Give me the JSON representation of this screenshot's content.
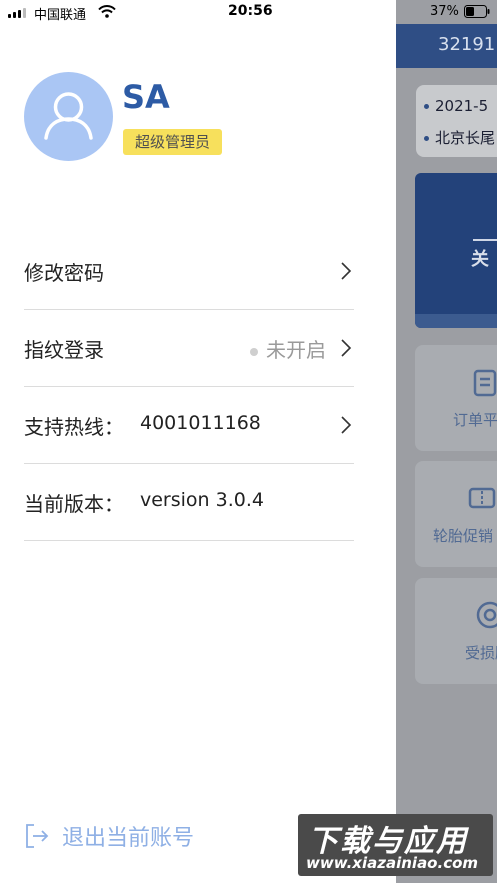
{
  "status_bar": {
    "carrier": "中国联通",
    "time": "20:56",
    "battery": "37%"
  },
  "background_app": {
    "topbar_text": "32191",
    "card_lines": [
      "2021-5",
      "北京长尾"
    ],
    "banner_text": "关",
    "tiles": [
      "订单平",
      "轮胎促销",
      "受损胎"
    ]
  },
  "profile": {
    "name": "SA",
    "role": "超级管理员"
  },
  "menu": {
    "change_password": "修改密码",
    "fingerprint_label": "指纹登录",
    "fingerprint_status": "未开启",
    "hotline_label": "支持热线：",
    "hotline_value": "4001011168",
    "version_label": "当前版本：",
    "version_value": "version 3.0.4"
  },
  "logout": {
    "label": "退出当前账号"
  },
  "watermark": {
    "line1": "下载与应用",
    "line2": "www.xiazainiao.com"
  },
  "colors": {
    "accent": "#2d5ba5",
    "avatar_bg": "#aac6f4",
    "badge_bg": "#f7e05c",
    "logout": "#8fb0e5"
  }
}
